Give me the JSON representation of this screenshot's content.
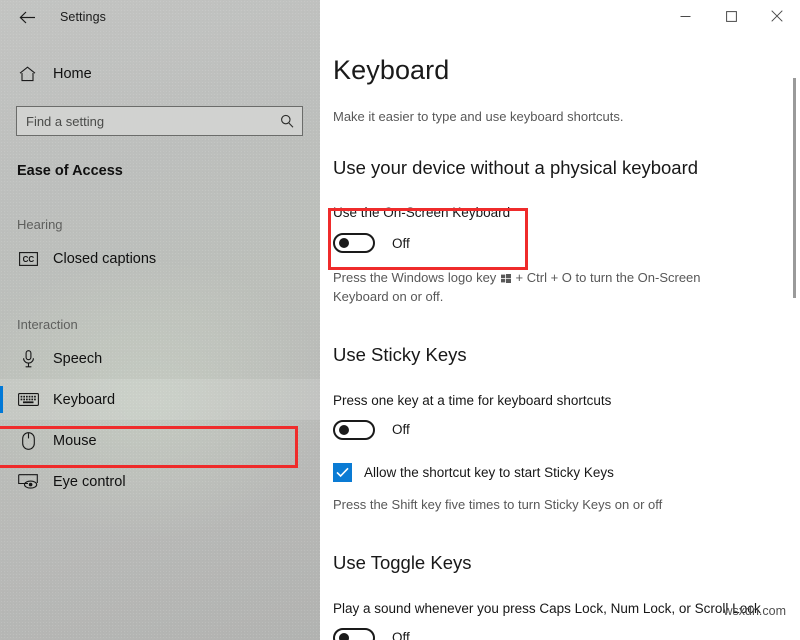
{
  "window": {
    "app_title": "Settings",
    "back_icon": "back-arrow-icon",
    "controls": {
      "minimize": "–",
      "maximize": "□",
      "close": "✕"
    }
  },
  "sidebar": {
    "home": {
      "label": "Home",
      "icon": "home-icon"
    },
    "search": {
      "placeholder": "Find a setting",
      "value": "",
      "icon": "search-icon"
    },
    "category_title": "Ease of Access",
    "groups": [
      {
        "label": "Hearing",
        "items": [
          {
            "label": "Closed captions",
            "icon": "closed-captions-icon",
            "selected": false
          }
        ]
      },
      {
        "label": "Interaction",
        "items": [
          {
            "label": "Speech",
            "icon": "microphone-icon",
            "selected": false
          },
          {
            "label": "Keyboard",
            "icon": "keyboard-icon",
            "selected": true
          },
          {
            "label": "Mouse",
            "icon": "mouse-icon",
            "selected": false
          },
          {
            "label": "Eye control",
            "icon": "eye-control-icon",
            "selected": false
          }
        ]
      }
    ]
  },
  "main": {
    "title": "Keyboard",
    "subtitle": "Make it easier to type and use keyboard shortcuts.",
    "sections": [
      {
        "heading": "Use your device without a physical keyboard",
        "setting_label": "Use the On-Screen Keyboard",
        "toggle_state": "Off",
        "hint_before_key": "Press the Windows logo key",
        "hint_after_key": "+ Ctrl + O to turn the On-Screen Keyboard on or off."
      },
      {
        "heading": "Use Sticky Keys",
        "setting_label": "Press one key at a time for keyboard shortcuts",
        "toggle_state": "Off",
        "checkbox_label": "Allow the shortcut key to start Sticky Keys",
        "checkbox_checked": true,
        "hint": "Press the Shift key five times to turn Sticky Keys on or off"
      },
      {
        "heading": "Use Toggle Keys",
        "setting_label": "Play a sound whenever you press Caps Lock, Num Lock, or Scroll Lock",
        "toggle_state": "Off"
      }
    ]
  },
  "watermark": "wsxdn.com",
  "colors": {
    "accent": "#0078d7",
    "checkbox": "#0a7bd4",
    "annotation": "#ef2b2b",
    "sidebar_bg": "#bdbfbd"
  }
}
